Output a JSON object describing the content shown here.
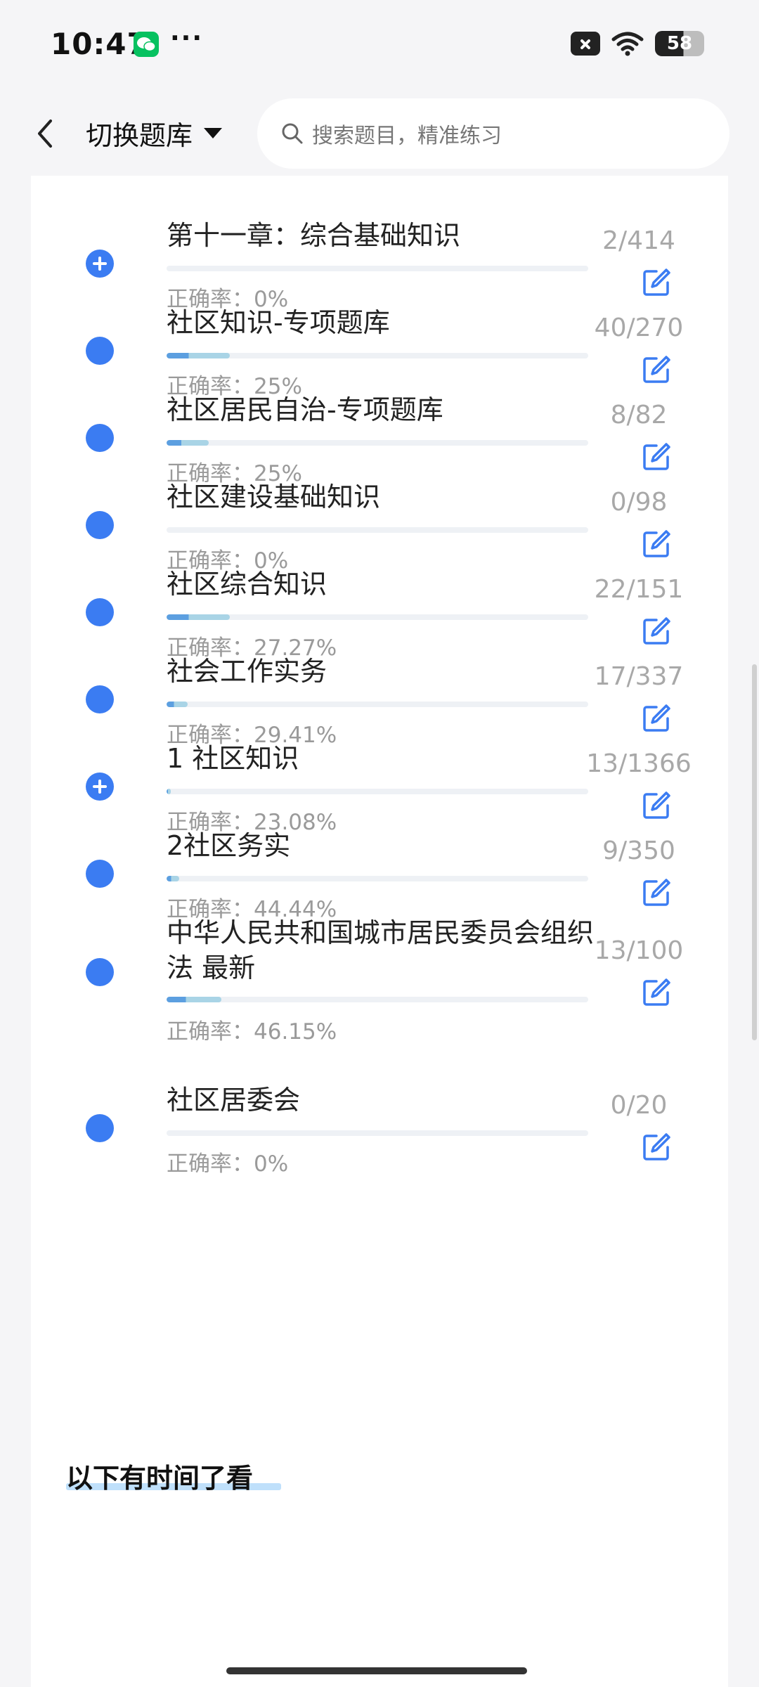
{
  "status": {
    "time": "10:47",
    "more": "···",
    "battery": "58"
  },
  "header": {
    "switch_label": "切换题库",
    "search_placeholder": "搜索题目，精准练习"
  },
  "items": [
    {
      "title": "第十一章：综合基础知识",
      "rate": "正确率：0%",
      "count": "2/414",
      "progress": 0.0,
      "icon": "plus"
    },
    {
      "title": "社区知识-专项题库",
      "rate": "正确率：25%",
      "count": "40/270",
      "progress": 0.15,
      "icon": "dot"
    },
    {
      "title": "社区居民自治-专项题库",
      "rate": "正确率：25%",
      "count": "8/82",
      "progress": 0.1,
      "icon": "dot"
    },
    {
      "title": "社区建设基础知识",
      "rate": "正确率：0%",
      "count": "0/98",
      "progress": 0.0,
      "icon": "dot"
    },
    {
      "title": "社区综合知识",
      "rate": "正确率：27.27%",
      "count": "22/151",
      "progress": 0.15,
      "icon": "dot"
    },
    {
      "title": "社会工作实务",
      "rate": "正确率：29.41%",
      "count": "17/337",
      "progress": 0.05,
      "icon": "dot"
    },
    {
      "title": "1 社区知识",
      "rate": "正确率：23.08%",
      "count": "13/1366",
      "progress": 0.01,
      "icon": "plus"
    },
    {
      "title": "2社区务实",
      "rate": "正确率：44.44%",
      "count": "9/350",
      "progress": 0.03,
      "icon": "dot"
    },
    {
      "title": "中华人民共和国城市居民委员会组织法 最新",
      "rate": "正确率：46.15%",
      "count": "13/100",
      "progress": 0.13,
      "icon": "dot"
    }
  ],
  "section": {
    "title": "以下有时间了看"
  },
  "section_items": [
    {
      "title": "社区居委会",
      "rate": "正确率：0%",
      "count": "0/20",
      "progress": 0.0,
      "icon": "dot"
    }
  ]
}
